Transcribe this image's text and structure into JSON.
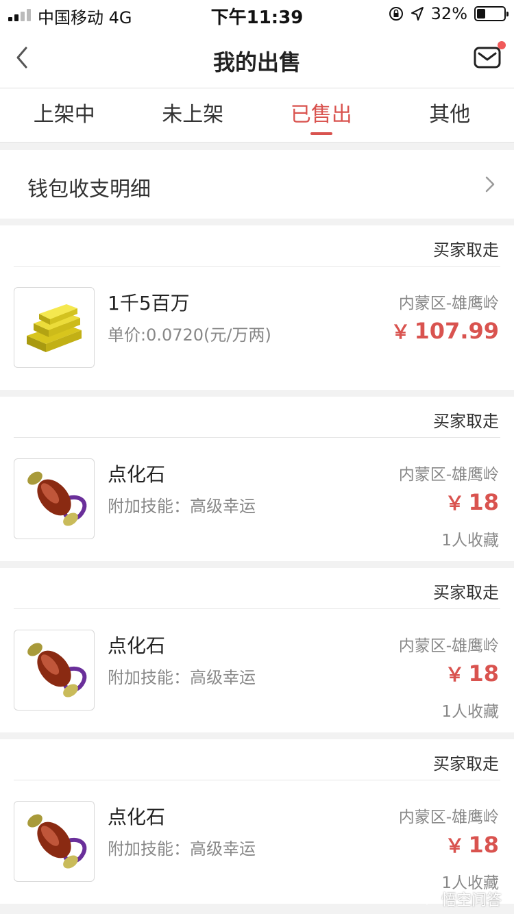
{
  "status_bar": {
    "carrier": "中国移动  4G",
    "time": "下午11:39",
    "battery": "32%"
  },
  "nav": {
    "title": "我的出售"
  },
  "tabs": [
    {
      "label": "上架中"
    },
    {
      "label": "未上架"
    },
    {
      "label": "已售出",
      "active": true
    },
    {
      "label": "其他"
    }
  ],
  "wallet": {
    "label": "钱包收支明细"
  },
  "orders": [
    {
      "status": "买家取走",
      "name": "1千5百万",
      "sub": "单价:0.0720(元/万两)",
      "server": "内蒙区-雄鹰岭",
      "currency": "￥",
      "price": "107.99",
      "favorites": "",
      "icon": "gold-bars-icon"
    },
    {
      "status": "买家取走",
      "name": "点化石",
      "sub": "附加技能：高级幸运",
      "server": "内蒙区-雄鹰岭",
      "currency": "￥",
      "price": "18",
      "favorites": "1人收藏",
      "icon": "jade-stone-icon"
    },
    {
      "status": "买家取走",
      "name": "点化石",
      "sub": "附加技能：高级幸运",
      "server": "内蒙区-雄鹰岭",
      "currency": "￥",
      "price": "18",
      "favorites": "1人收藏",
      "icon": "jade-stone-icon"
    },
    {
      "status": "买家取走",
      "name": "点化石",
      "sub": "附加技能：高级幸运",
      "server": "内蒙区-雄鹰岭",
      "currency": "￥",
      "price": "18",
      "favorites": "1人收藏",
      "icon": "jade-stone-icon"
    }
  ],
  "watermark": "悟空问答",
  "colors": {
    "accent": "#d9534f",
    "notification_dot": "#f05a5a",
    "background": "#f2f2f2"
  }
}
